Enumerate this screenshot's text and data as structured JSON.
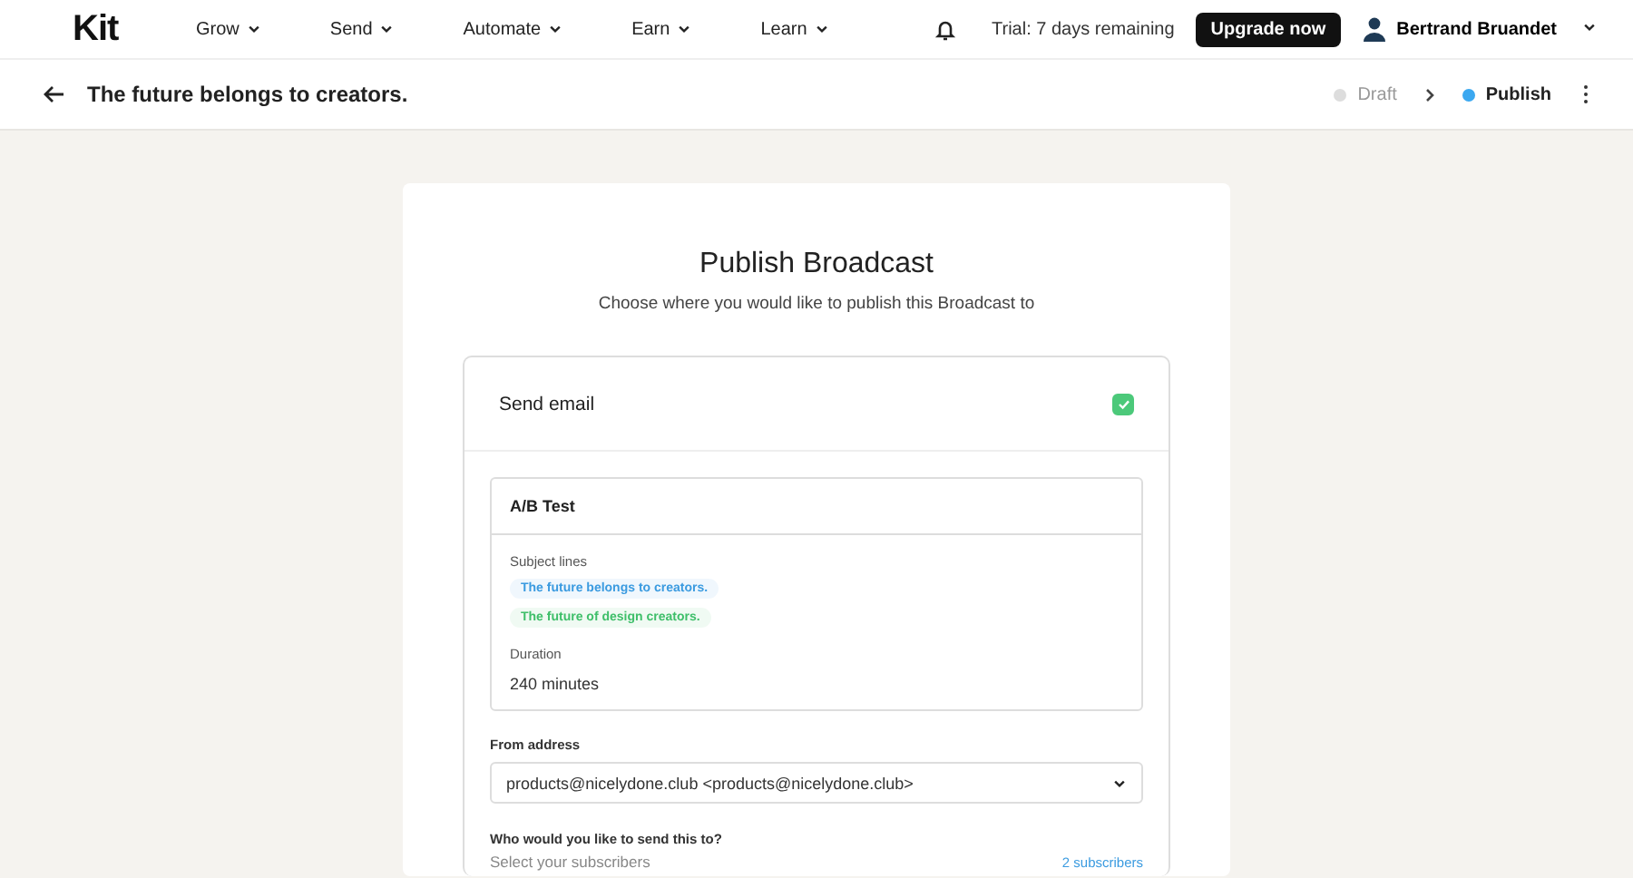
{
  "nav": {
    "logo": "Kit",
    "menus": [
      "Grow",
      "Send",
      "Automate",
      "Earn",
      "Learn"
    ],
    "trial": "Trial: 7 days remaining",
    "upgrade": "Upgrade now",
    "user": "Bertrand Bruandet"
  },
  "header": {
    "title": "The future belongs to creators.",
    "stages": [
      {
        "label": "Draft",
        "selected": false
      },
      {
        "label": "Publish",
        "selected": true
      }
    ]
  },
  "publish": {
    "title": "Publish Broadcast",
    "subtitle": "Choose where you would like to publish this Broadcast to",
    "send_email": {
      "label": "Send email",
      "checked": true
    },
    "ab_test": {
      "title": "A/B Test",
      "subject_label": "Subject lines",
      "subjects": [
        {
          "text": "The future belongs to creators.",
          "color": "#3b9be0"
        },
        {
          "text": "The future of design creators.",
          "color": "#3fbf6a"
        }
      ],
      "duration_label": "Duration",
      "duration": "240 minutes"
    },
    "from_label": "From address",
    "from_value": "products@nicelydone.club <products@nicelydone.club>",
    "recipients_label": "Who would you like to send this to?",
    "recipients_placeholder": "Select your subscribers",
    "recipients_count": "2 subscribers"
  }
}
